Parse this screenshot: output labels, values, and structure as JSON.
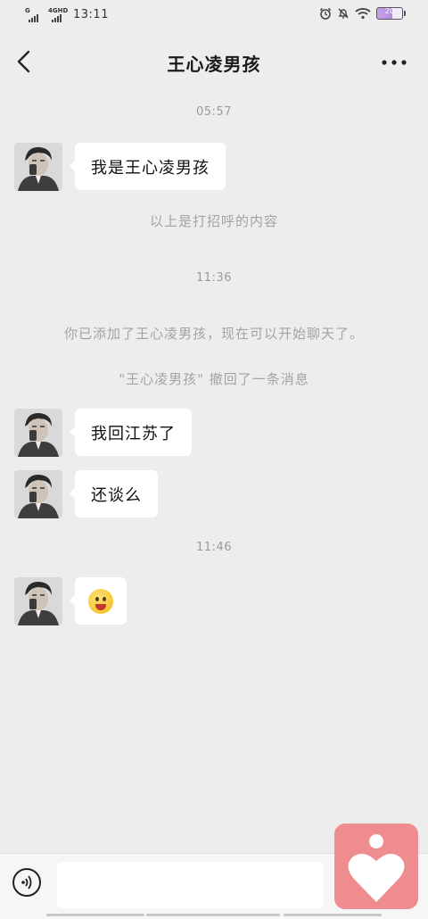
{
  "status_bar": {
    "network_1": "G",
    "network_2": "4GHD",
    "time": "13:11",
    "battery_level": "20"
  },
  "header": {
    "title": "王心凌男孩"
  },
  "messages": [
    {
      "timestamp": "05:57"
    },
    {
      "bubble": "我是王心凌男孩"
    },
    {
      "system": "以上是打招呼的内容"
    },
    {
      "timestamp": "11:36"
    },
    {
      "system": "你已添加了王心凌男孩，现在可以开始聊天了。"
    },
    {
      "system": "\"王心凌男孩\" 撤回了一条消息"
    },
    {
      "bubble": "我回江苏了"
    },
    {
      "bubble": "还谈么"
    },
    {
      "timestamp": "11:46"
    },
    {
      "emoji": "grimacing-face-emoji"
    }
  ],
  "colors": {
    "background": "#ededed",
    "bubble": "#ffffff",
    "heart_button": "#ef8c8f"
  }
}
